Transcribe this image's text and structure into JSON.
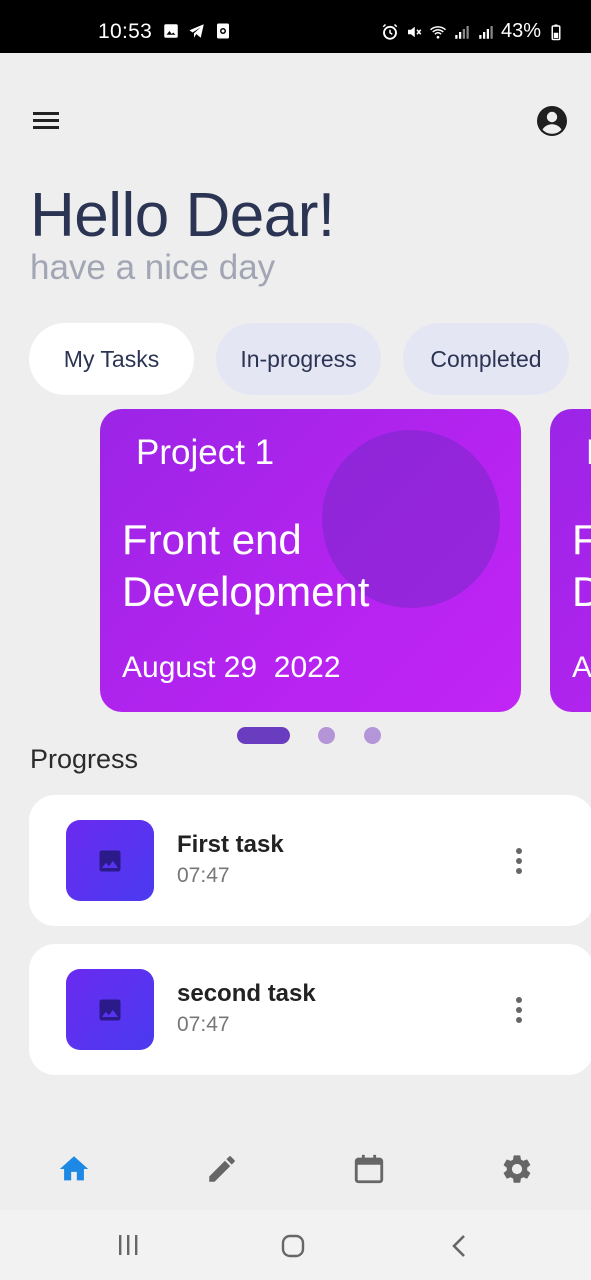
{
  "status_bar": {
    "time": "10:53",
    "battery": "43%",
    "left_icons": [
      "image-icon",
      "telegram-icon",
      "screen-record-icon"
    ],
    "right_icons": [
      "alarm-icon",
      "mute-icon",
      "wifi-icon",
      "signal-icon",
      "signal-icon",
      "battery-icon"
    ]
  },
  "top_bar": {
    "menu_icon": "hamburger-menu-icon",
    "account_icon": "account-circle-icon"
  },
  "header": {
    "greeting": "Hello Dear!",
    "subtitle": "have a nice day"
  },
  "tabs": [
    {
      "label": "My Tasks",
      "active": true
    },
    {
      "label": "In-progress",
      "active": false
    },
    {
      "label": "Completed",
      "active": false
    }
  ],
  "project_cards": [
    {
      "project": "Project 1",
      "title": "Front end Development",
      "date": "August 29  2022"
    },
    {
      "project": "P",
      "title": "F D",
      "date": "A"
    }
  ],
  "carousel": {
    "page_count": 3,
    "active_index": 0
  },
  "progress": {
    "title": "Progress",
    "tasks": [
      {
        "name": "First task",
        "time": "07:47",
        "thumb_icon": "image-icon",
        "menu_icon": "more-vert-icon"
      },
      {
        "name": "second task",
        "time": "07:47",
        "thumb_icon": "image-icon",
        "menu_icon": "more-vert-icon"
      }
    ]
  },
  "bottom_nav": [
    {
      "icon": "home-icon",
      "active": true
    },
    {
      "icon": "edit-icon",
      "active": false
    },
    {
      "icon": "calendar-icon",
      "active": false
    },
    {
      "icon": "settings-icon",
      "active": false
    }
  ],
  "system_nav": [
    "recent-apps-icon",
    "home-button-icon",
    "back-icon"
  ],
  "colors": {
    "background": "#eeeeee",
    "accent": "#1e88e5",
    "card_gradient_start": "#9b25e6",
    "card_gradient_end": "#c125f6",
    "text_dark": "#2b3553",
    "text_muted": "#a2a6b4",
    "thumb": "#5a33f0"
  }
}
